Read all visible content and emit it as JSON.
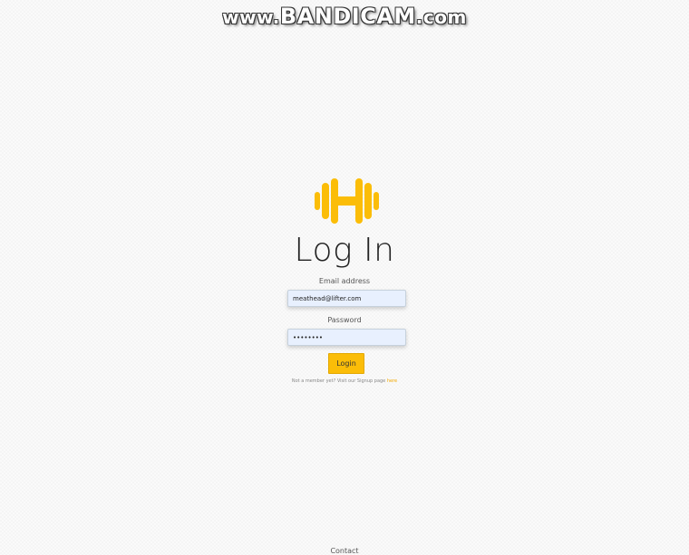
{
  "watermark": {
    "prefix": "www.",
    "brand": "BANDICAM",
    "suffix": ".com"
  },
  "logo": {
    "icon": "dumbbell-h-icon",
    "color": "#FBBD08"
  },
  "page": {
    "title": "Log In"
  },
  "form": {
    "email_label": "Email address",
    "email_value": "meathead@lifter.com",
    "password_label": "Password",
    "password_value": "••••••••",
    "submit_label": "Login"
  },
  "signup": {
    "text": "Not a member yet? Visit our Signup page ",
    "link_text": "here"
  },
  "footer": {
    "contact": "Contact"
  },
  "colors": {
    "accent": "#FBBD08",
    "input_bg": "#E8F0FE"
  }
}
